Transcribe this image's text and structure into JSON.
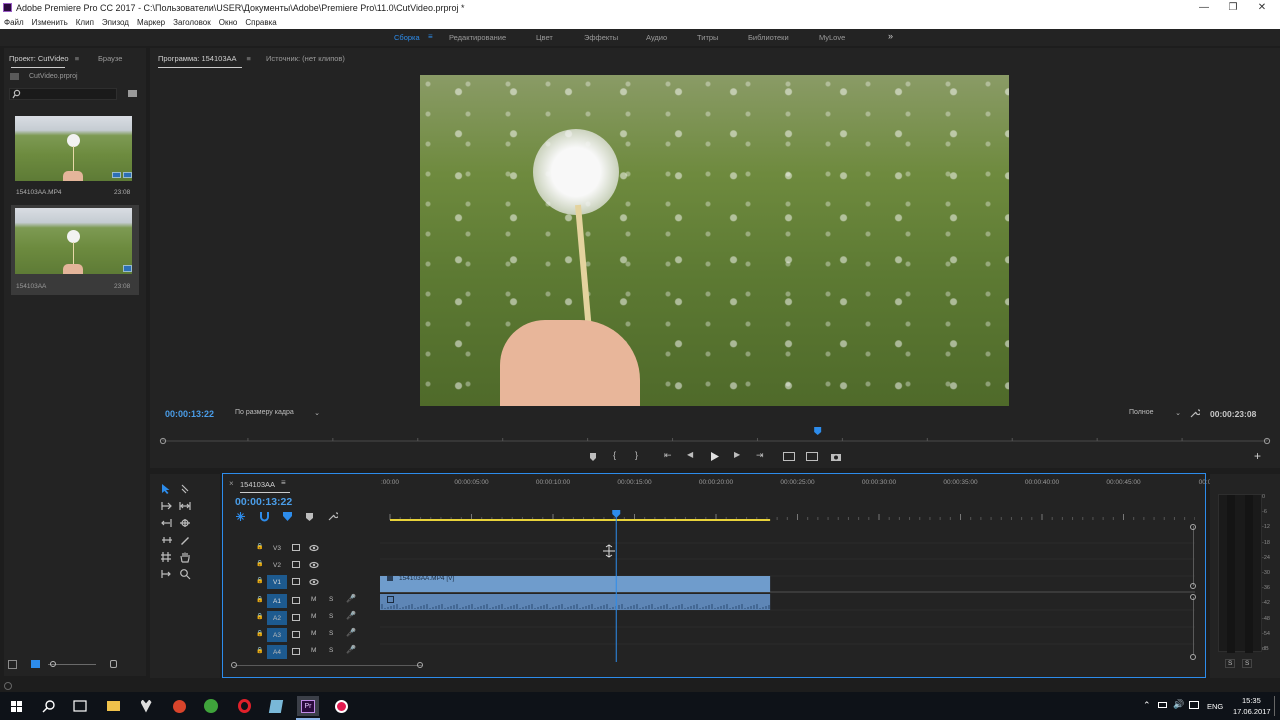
{
  "window": {
    "title": "Adobe Premiere Pro CC 2017 - C:\\Пользователи\\USER\\Документы\\Adobe\\Premiere Pro\\11.0\\CutVideo.prproj *"
  },
  "menu": [
    "Файл",
    "Изменить",
    "Клип",
    "Эпизод",
    "Маркер",
    "Заголовок",
    "Окно",
    "Справка"
  ],
  "workspaces": [
    "Сборка",
    "Редактирование",
    "Цвет",
    "Эффекты",
    "Аудио",
    "Титры",
    "Библиотеки",
    "MyLove"
  ],
  "workspace_more": "»",
  "project": {
    "tab": "Проект: CutVideo",
    "tab2": "Браузе",
    "file": "CutVideo.prproj",
    "search_placeholder": "",
    "items": [
      {
        "name": "154103AA.MP4",
        "duration": "23:08"
      },
      {
        "name": "154103AA",
        "duration": "23:08"
      }
    ]
  },
  "program": {
    "tab": "Программа: 154103AA",
    "source_tab": "Источник: (нет клипов)",
    "timecode": "00:00:13:22",
    "fit": "По размеру кадра",
    "quality": "Полное",
    "duration": "00:00:23:08",
    "playhead_fraction": 0.593
  },
  "timeline": {
    "tab": "154103AA",
    "timecode": "00:00:13:22",
    "ruler": [
      ":00:00",
      "00:00:05:00",
      "00:00:10:00",
      "00:00:15:00",
      "00:00:20:00",
      "00:00:25:00",
      "00:00:30:00",
      "00:00:35:00",
      "00:00:40:00",
      "00:00:45:00",
      "00:0"
    ],
    "video_tracks": [
      "V3",
      "V2",
      "V1"
    ],
    "audio_tracks": [
      "A1",
      "A2",
      "A3",
      "A4"
    ],
    "track_m": "M",
    "track_s": "S",
    "clip_label": "154103AA.MP4 [V]"
  },
  "meter": {
    "labels": [
      "0",
      "-6",
      "-12",
      "-18",
      "-24",
      "-30",
      "-36",
      "-42",
      "-48",
      "-54",
      "dB"
    ],
    "solo": [
      "S",
      "S"
    ]
  },
  "taskbar": {
    "lang": "ENG",
    "time": "15:35",
    "date": "17.06.2017"
  },
  "colors": {
    "accent": "#2d8ceb",
    "timecode": "#4a9de8",
    "clip": "#6f9ccc",
    "workarea": "#e8d23a"
  }
}
